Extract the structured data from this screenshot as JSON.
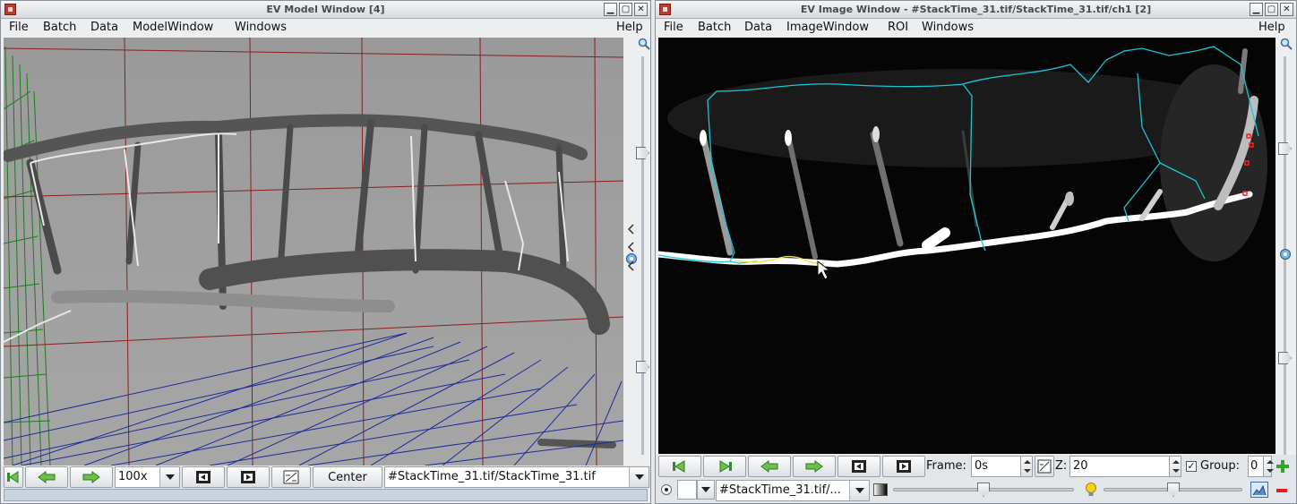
{
  "left_window": {
    "title": "EV Model Window [4]",
    "controls": {
      "minimize": "▁",
      "maximize": "▢",
      "close": "✕"
    },
    "menu": [
      "File",
      "Batch",
      "Data",
      "ModelWindow",
      "Windows"
    ],
    "help": "Help",
    "toolbar": {
      "zoom_value": "100x",
      "center_label": "Center",
      "channel_path": "#StackTime_31.tif/StackTime_31.tif"
    }
  },
  "right_window": {
    "title": "EV Image Window - #StackTime_31.tif/StackTime_31.tif/ch1 [2]",
    "controls": {
      "minimize": "▁",
      "maximize": "▢",
      "close": "✕"
    },
    "menu": [
      "File",
      "Batch",
      "Data",
      "ImageWindow",
      "ROI",
      "Windows"
    ],
    "help": "Help",
    "toolbar": {
      "frame_label": "Frame:",
      "frame_value": "0s",
      "z_label": "Z:",
      "z_value": "20",
      "group_label": "Group:",
      "group_checked": true,
      "group_value": "0",
      "channel_path": "#StackTime_31.tif/..."
    }
  },
  "colors": {
    "trace_cyan": "#19c6d6",
    "trace_yellow": "#e8e040",
    "grid_red": "#8a1f1f",
    "grid_blue": "#1f2a9a",
    "grid_green": "#1f7a1f",
    "marker_red": "#ff2020",
    "status_blue": "#c9d3de"
  }
}
